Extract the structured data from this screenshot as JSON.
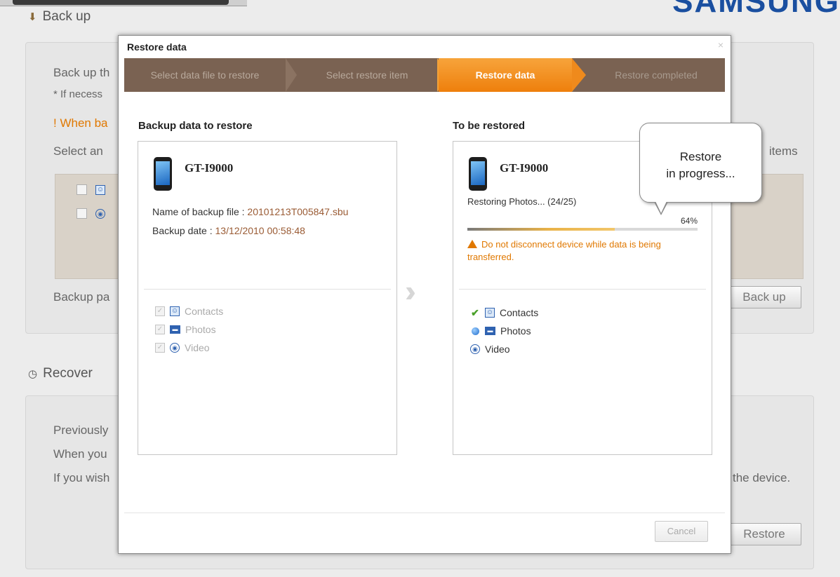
{
  "background": {
    "brand": "SAMSUNG",
    "backup_section": {
      "title": "Back up",
      "line1": "Back up th",
      "line2": "* If necess",
      "warning": "! When ba",
      "select": "Select an",
      "items_label": "items",
      "backup_path": "Backup pa",
      "backup_button": "Back up"
    },
    "recover_section": {
      "title": "Recover",
      "line1": "Previously",
      "line2": "When you",
      "line3": "If you wish",
      "line3_end": "the device.",
      "restore_button": "Restore"
    }
  },
  "dialog": {
    "title": "Restore data",
    "close_label": "×",
    "steps": [
      {
        "label": "Select data file to restore",
        "state": "done"
      },
      {
        "label": "Select restore item",
        "state": "done"
      },
      {
        "label": "Restore data",
        "state": "active"
      },
      {
        "label": "Restore completed",
        "state": "pending"
      }
    ],
    "left": {
      "title": "Backup data to restore",
      "device": "GT-I9000",
      "file_label": "Name of backup file : ",
      "file_value": "20101213T005847.sbu",
      "date_label": "Backup date : ",
      "date_value": "13/12/2010 00:58:48",
      "items": [
        {
          "label": "Contacts",
          "icon": "contacts-icon"
        },
        {
          "label": "Photos",
          "icon": "photos-icon"
        },
        {
          "label": "Video",
          "icon": "video-icon"
        }
      ]
    },
    "right": {
      "title": "To be restored",
      "device": "GT-I9000",
      "status": "Restoring  Photos... (24/25)",
      "progress_percent": 64,
      "progress_label": "64%",
      "warning": "Do not disconnect device while data is being transferred.",
      "items": [
        {
          "label": "Contacts",
          "icon": "contacts-icon",
          "state": "done"
        },
        {
          "label": "Photos",
          "icon": "photos-icon",
          "state": "in-progress"
        },
        {
          "label": "Video",
          "icon": "video-icon",
          "state": "pending"
        }
      ]
    },
    "callout": {
      "line1": "Restore",
      "line2": "in progress..."
    },
    "cancel_button": "Cancel"
  },
  "colors": {
    "accent_orange": "#f28a12",
    "step_bar": "#7a6252",
    "warning": "#e07800",
    "brand_blue": "#1a4fa0"
  }
}
